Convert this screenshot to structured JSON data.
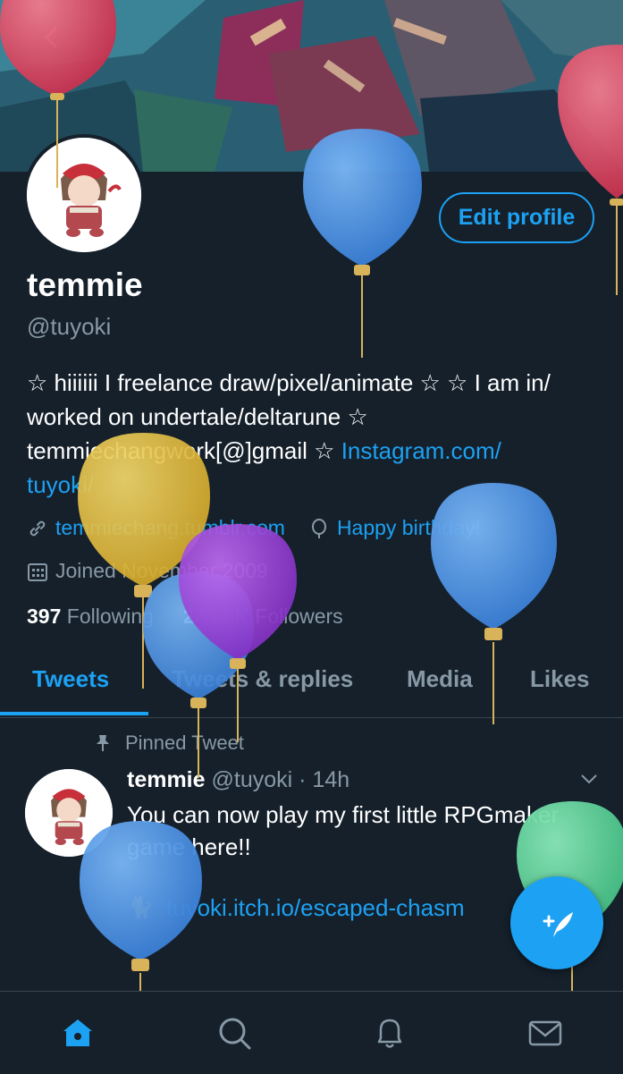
{
  "profile": {
    "display_name": "temmie",
    "handle": "@tuyoki",
    "edit_profile_label": "Edit profile",
    "bio_text": "☆ hiiiiii I freelance draw/pixel/animate ☆ ☆ I am in/ worked on undertale/deltarune ☆ temmiechangwork[@]gmail ☆ ",
    "bio_link_line1": "Instagram.com/",
    "bio_link_line2": "tuyoki/",
    "website": "temmiechang.tumblr.com",
    "birthday": "Happy birthday!",
    "joined": "Joined November 2009",
    "following_count": "397",
    "following_label": "Following",
    "followers_count": "204.6K",
    "followers_label": "Followers"
  },
  "tabs": [
    {
      "label": "Tweets",
      "active": true
    },
    {
      "label": "Tweets & replies",
      "active": false
    },
    {
      "label": "Media",
      "active": false
    },
    {
      "label": "Likes",
      "active": false
    }
  ],
  "tweet": {
    "pinned_label": "Pinned Tweet",
    "author": "temmie",
    "handle": "@tuyoki",
    "time": "· 14h",
    "text": "You can now play my first little RPGmaker game here!!",
    "link": "tuyoki.itch.io/escaped-chasm"
  },
  "icons": {
    "back": "chevron-left-icon",
    "link": "link-icon",
    "birthday": "balloon-icon",
    "calendar": "calendar-icon",
    "pin": "pin-icon",
    "compose": "compose-tweet-icon",
    "nav": [
      "home-icon",
      "search-icon",
      "bell-icon",
      "mail-icon"
    ]
  },
  "colors": {
    "background": "#15202b",
    "accent": "#1da1f2",
    "muted": "#8899a6",
    "divider": "#38444d",
    "balloon_red": "#d9415f",
    "balloon_blue": "#4a90e2",
    "balloon_yellow": "#e8c33c",
    "balloon_purple": "#9b3fd6",
    "balloon_green": "#5fd39b"
  }
}
